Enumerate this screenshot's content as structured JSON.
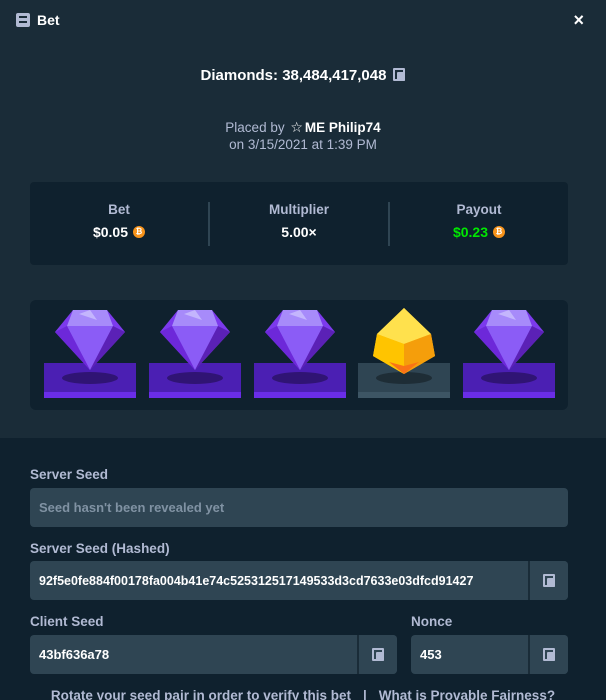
{
  "modal": {
    "title": "Bet",
    "title_icon": "list-icon",
    "close_label": "×"
  },
  "game": {
    "headline": "Diamonds: 38,484,417,048",
    "placed_prefix": "Placed by",
    "player": "ME Philip74",
    "date": "on 3/15/2021 at 1:39 PM"
  },
  "stats": {
    "bet_label": "Bet",
    "bet_value": "$0.05",
    "multiplier_label": "Multiplier",
    "multiplier_value": "5.00×",
    "payout_label": "Payout",
    "payout_value": "$0.23",
    "currency_icon": "bitcoin-icon",
    "payout_color": "#00e701"
  },
  "gems": [
    {
      "name": "purple-gem",
      "color": "#8b5cf6"
    },
    {
      "name": "purple-gem",
      "color": "#8b5cf6"
    },
    {
      "name": "purple-gem",
      "color": "#8b5cf6"
    },
    {
      "name": "yellow-gem",
      "color": "#ffc400"
    },
    {
      "name": "purple-gem",
      "color": "#8b5cf6"
    }
  ],
  "fairness": {
    "server_seed_label": "Server Seed",
    "server_seed_placeholder": "Seed hasn't been revealed yet",
    "server_seed_hashed_label": "Server Seed (Hashed)",
    "server_seed_hashed_value": "92f5e0fe884f00178fa004b41e74c525312517149533d3cd7633e03dfcd91427",
    "client_seed_label": "Client Seed",
    "client_seed_value": "43bf636a78",
    "nonce_label": "Nonce",
    "nonce_value": "453"
  },
  "footer": {
    "rotate_link": "Rotate your seed pair in order to verify this bet",
    "separator": "|",
    "fairness_link": "What is Provable Fairness?"
  },
  "colors": {
    "background": "#1a2c38",
    "panel": "#0f212e",
    "input": "#2f4553",
    "muted_text": "#b1bad3"
  }
}
